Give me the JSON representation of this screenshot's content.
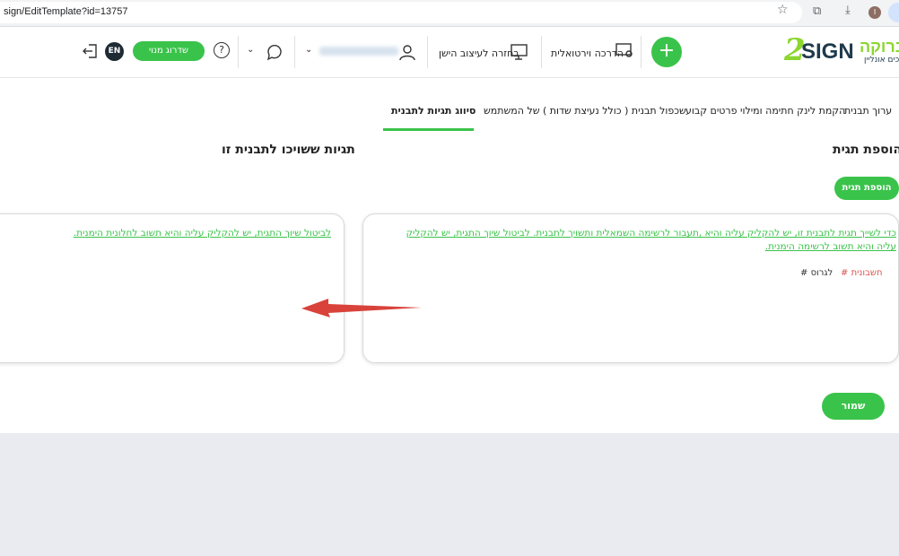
{
  "browser": {
    "url": "sign/EditTemplate?id=13757",
    "profile_initial": "I"
  },
  "header": {
    "brand_name": "ברוקה",
    "brand_sub": "כים אונליין",
    "logo_text": "SIGN",
    "plus_label": "+",
    "virtual_training": "הדרכה וירטואלית",
    "back_to_old_design": "בחזרה לעיצוב הישן",
    "upgrade_label": "שדרוג מנוי",
    "lang_label": "EN",
    "help_label": "?"
  },
  "tabs": [
    {
      "label": "ערוך תבנית"
    },
    {
      "label": "הקמת לינק חתימה ומילוי פרטים קבוע"
    },
    {
      "label": "שכפול תבנית ( כולל נעיצת שדות ) של המשתמש"
    },
    {
      "label": "סיווג תגיות לתבנית",
      "active": true
    }
  ],
  "main": {
    "add_tag_heading": "הוספת תגית",
    "assigned_tags_heading": "תגיות ששויכו לתבנית זו",
    "add_tag_button": "הוספת תגית",
    "right_instructions": "כדי לשייך תגית לתבנית זו, יש להקליק עליה והיא ,תעבור לרשימה השמאלית ותשויך לתבנית. לביטול שיוך התגית, יש להקליק עליה והיא תשוב לרשימה הימנית.",
    "left_instructions": "לביטול שיוך התגית, יש להקליק עליה והיא תשוב לחלונית הימנית.",
    "available_tags": [
      {
        "label": "# חשבונית",
        "color": "#d9534f"
      },
      {
        "label": "# לגרוס",
        "color": "#333333"
      }
    ],
    "save_button": "שמור"
  },
  "colors": {
    "accent": "#3ac34a",
    "arrow": "#d9423a"
  }
}
